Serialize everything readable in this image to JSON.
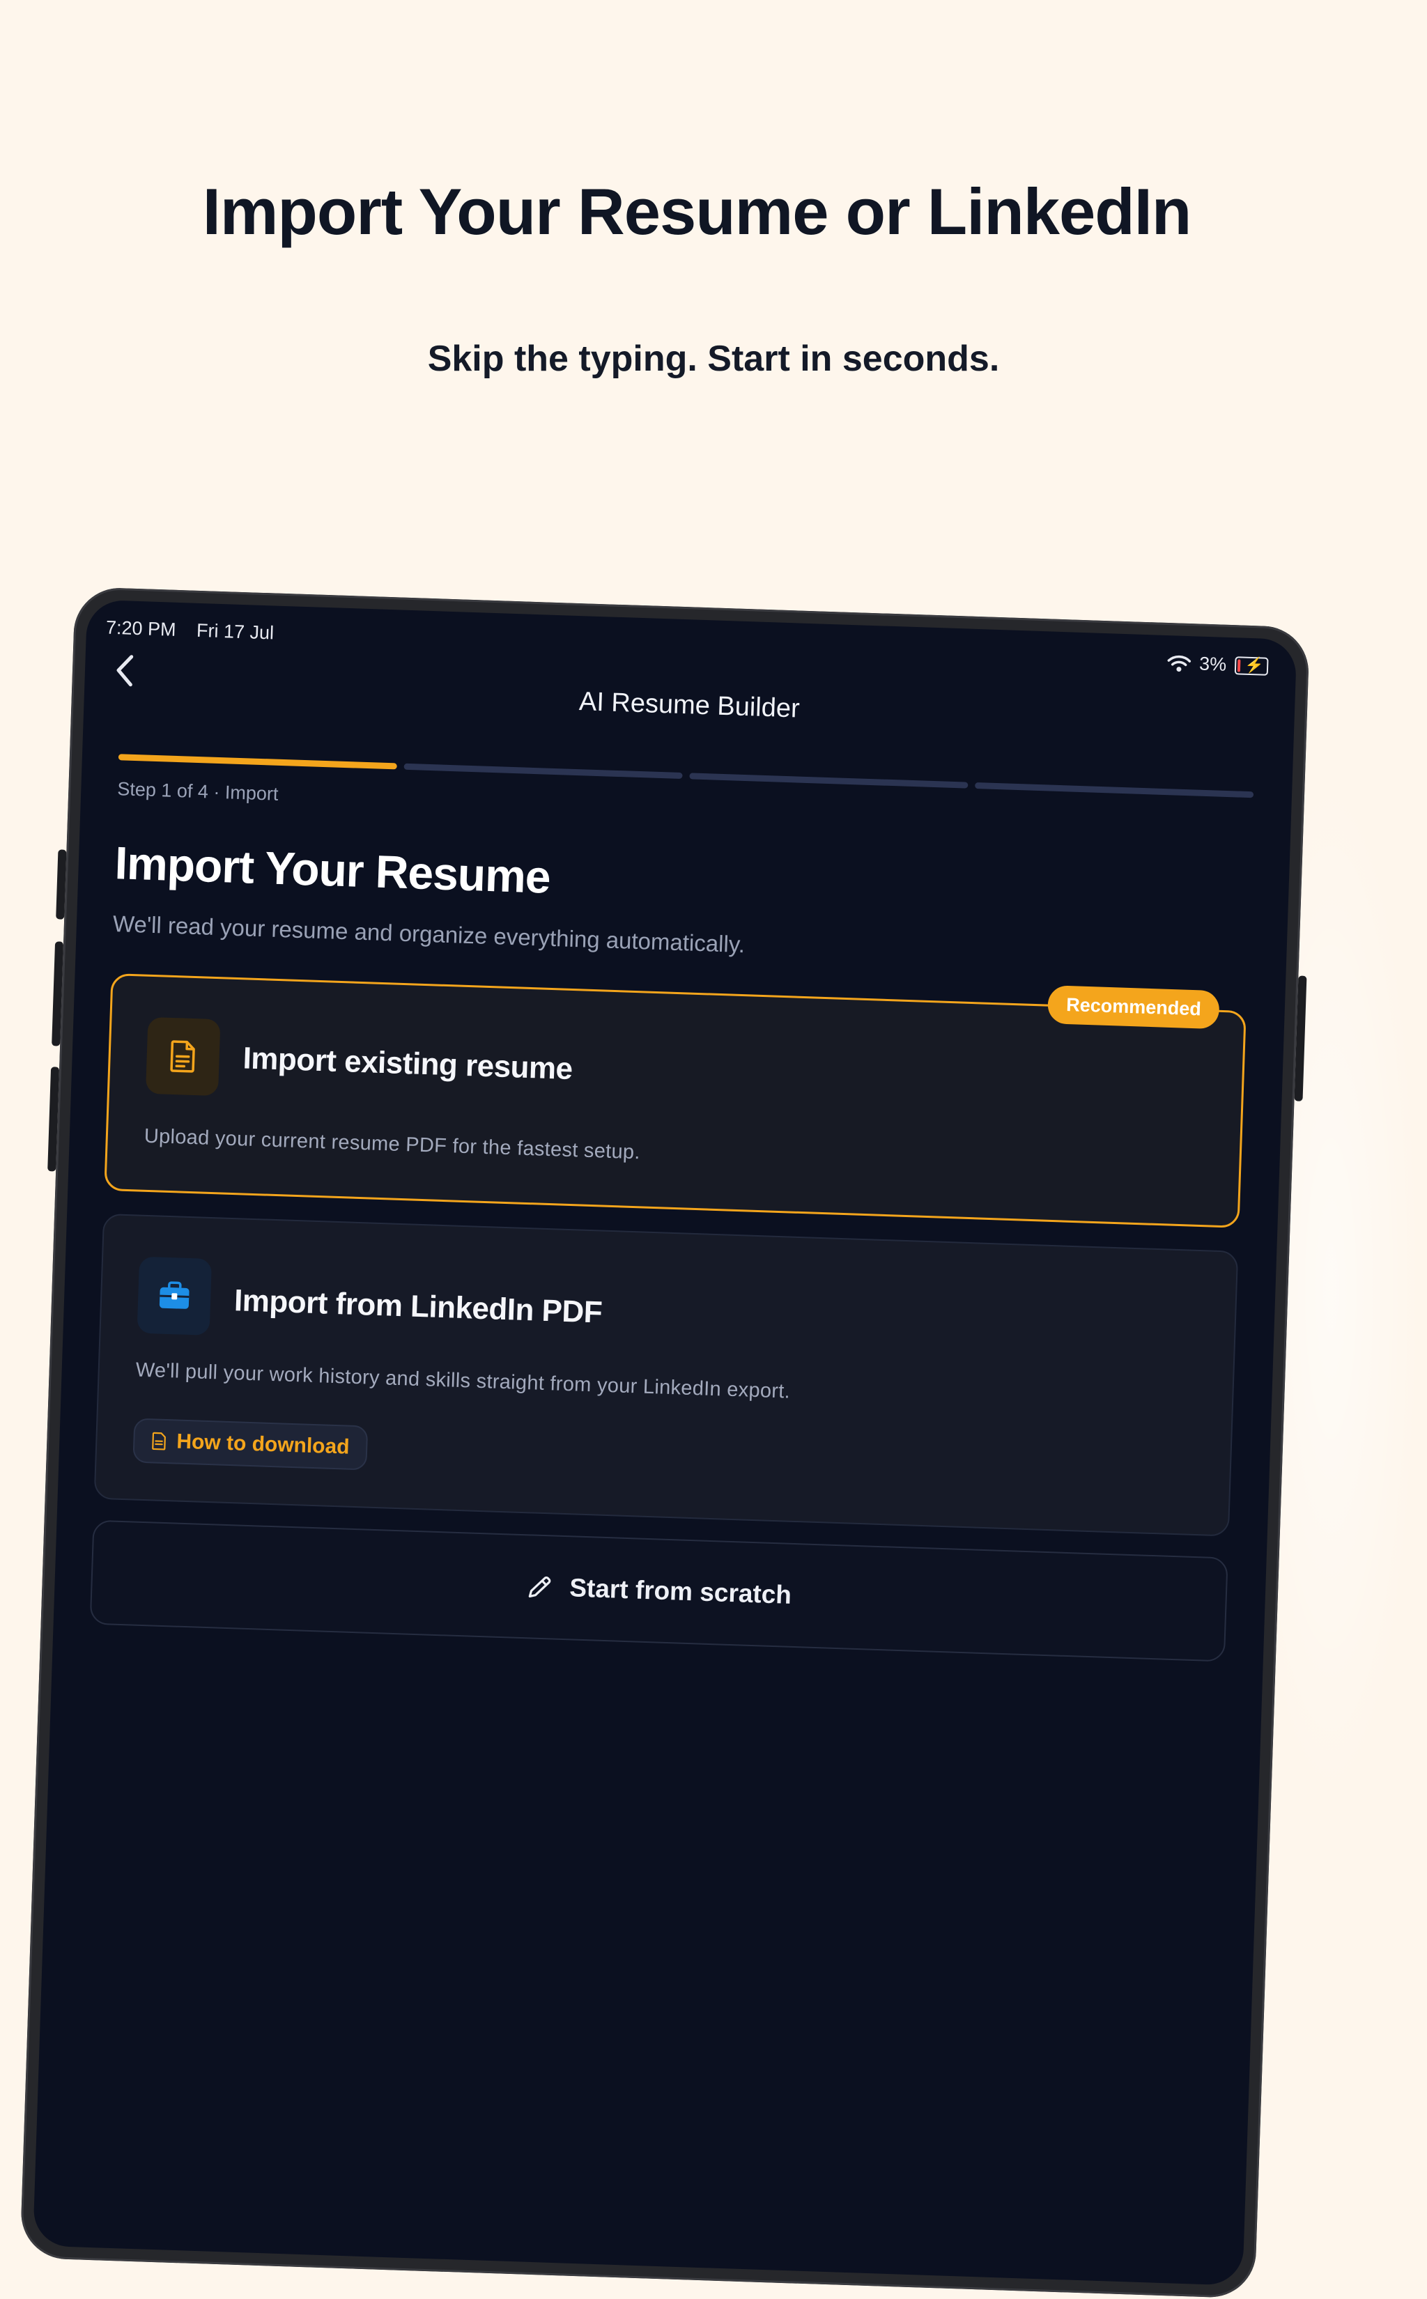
{
  "promo": {
    "headline": "Import Your Resume or LinkedIn",
    "subheadline": "Skip the typing. Start in seconds."
  },
  "status_bar": {
    "time": "7:20 PM",
    "date": "Fri 17 Jul",
    "battery": "3%"
  },
  "nav": {
    "title": "AI Resume Builder",
    "back_icon": "chevron-left-icon"
  },
  "progress": {
    "total_steps": 4,
    "current_step": 1,
    "label": "Step 1 of 4 · Import",
    "colors": {
      "active": "#f4a51c",
      "inactive": "#2b3452"
    }
  },
  "page": {
    "title": "Import Your Resume",
    "description": "We'll read your resume and organize everything automatically."
  },
  "options": [
    {
      "title": "Import existing resume",
      "description": "Upload your current resume PDF for the fastest setup.",
      "badge": "Recommended",
      "icon": "document-icon"
    },
    {
      "title": "Import from LinkedIn PDF",
      "description": "We'll pull your work history and skills straight from your LinkedIn export.",
      "link_label": "How to download",
      "icon": "briefcase-icon"
    }
  ],
  "scratch": {
    "label": "Start from scratch",
    "icon": "pencil-icon"
  },
  "colors": {
    "accent": "#f4a51c",
    "background": "#0b1020",
    "promo_background": "#fef6ec",
    "linkedin_blue": "#1d8ee6"
  }
}
